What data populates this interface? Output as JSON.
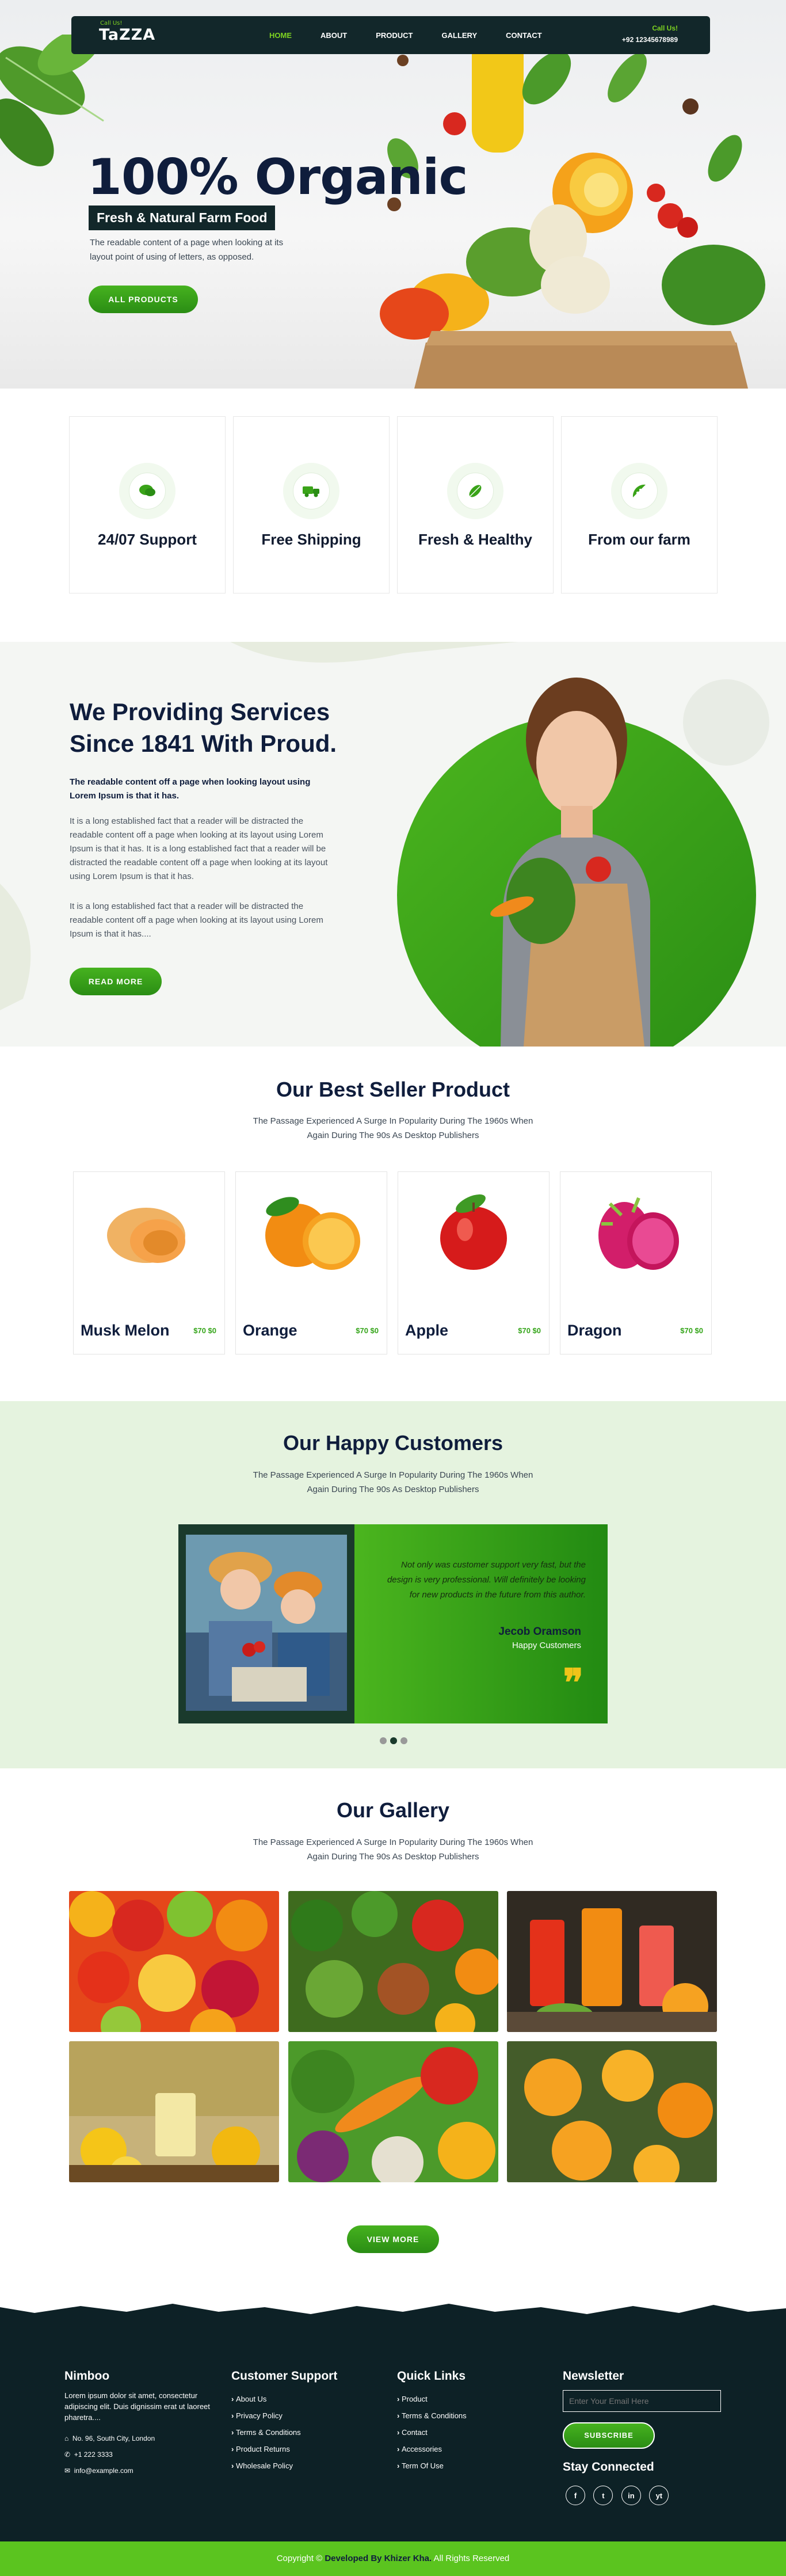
{
  "brand": {
    "name": "TaZZA",
    "tagline": "Call Us!"
  },
  "nav": {
    "items": [
      "HOME",
      "ABOUT",
      "PRODUCT",
      "GALLERY",
      "CONTACT"
    ],
    "active": "HOME",
    "call_label": "Call Us!",
    "call_number": "+92 12345678989"
  },
  "hero": {
    "title": "100% Organic",
    "tag": "Fresh & Natural Farm Food",
    "desc": "The readable content of a page when looking at its layout point of using of letters, as opposed.",
    "button": "ALL PRODUCTS"
  },
  "features": [
    {
      "label": "24/07 Support",
      "icon": "chat-icon"
    },
    {
      "label": "Free Shipping",
      "icon": "truck-icon"
    },
    {
      "label": "Fresh & Healthy",
      "icon": "leaf-icon"
    },
    {
      "label": "From our farm",
      "icon": "fruit-icon"
    }
  ],
  "services": {
    "title_line1": "We Providing Services",
    "title_line2": "Since 1841 With Proud.",
    "lead": "The readable content off a page when looking layout using Lorem Ipsum is that it has.",
    "p1": "It is a long established fact that a reader will be distracted the readable content off a page when looking at its layout using Lorem Ipsum is that it has. It is a long established fact that a reader will be distracted the readable content off a page when looking at its layout using Lorem Ipsum is that it has.",
    "p2": "It is a long established fact that a reader will be distracted the readable content off a page when looking at its layout using Lorem Ipsum is that it has....",
    "button": "READ MORE"
  },
  "best_seller": {
    "title": "Our Best Seller Product",
    "sub": "The Passage Experienced A Surge In Popularity During The 1960s When Again During The 90s As Desktop Publishers",
    "products": [
      {
        "name": "Musk Melon",
        "price": "$70 $0"
      },
      {
        "name": "Orange",
        "price": "$70 $0"
      },
      {
        "name": "Apple",
        "price": "$70 $0"
      },
      {
        "name": "Dragon",
        "price": "$70 $0"
      }
    ]
  },
  "customers": {
    "title": "Our Happy Customers",
    "sub": "The Passage Experienced A Surge In Popularity During The 1960s When Again During The 90s As Desktop Publishers",
    "quote": "Not only was customer support very fast, but the design is very professional. Will definitely be looking for new products in the future from this author.",
    "name": "Jecob Oramson",
    "role": "Happy Customers",
    "dots": 3,
    "active_dot": 2
  },
  "gallery": {
    "title": "Our Gallery",
    "sub": "The Passage Experienced A Surge In Popularity During The 1960s When Again During The 90s As Desktop Publishers",
    "button": "VIEW MORE"
  },
  "footer": {
    "about": {
      "title": "Nimboo",
      "text": "Lorem ipsum dolor sit amet, consectetur adipiscing elit. Duis dignissim erat ut laoreet pharetra....",
      "address": "No. 96, South City, London",
      "phone": "+1 222 3333",
      "email": "info@example.com"
    },
    "support": {
      "title": "Customer Support",
      "links": [
        "About Us",
        "Privacy Policy",
        "Terms & Conditions",
        "Product Returns",
        "Wholesale Policy"
      ]
    },
    "quick": {
      "title": "Quick Links",
      "links": [
        "Product",
        "Terms & Conditions",
        "Contact",
        "Accessories",
        "Term Of Use"
      ]
    },
    "newsletter": {
      "title": "Newsletter",
      "placeholder": "Enter Your Email Here",
      "button": "SUBSCRIBE",
      "social_title": "Stay Connected",
      "social": [
        "f",
        "t",
        "in",
        "yt"
      ]
    },
    "copyright_pre": "Copyright ©",
    "copyright_dev": "Developed By Khizer Kha.",
    "copyright_post": "All Rights Reserved"
  },
  "colors": {
    "accent": "#5bc41f",
    "dark": "#12272a",
    "navy": "#0f1d3c"
  }
}
